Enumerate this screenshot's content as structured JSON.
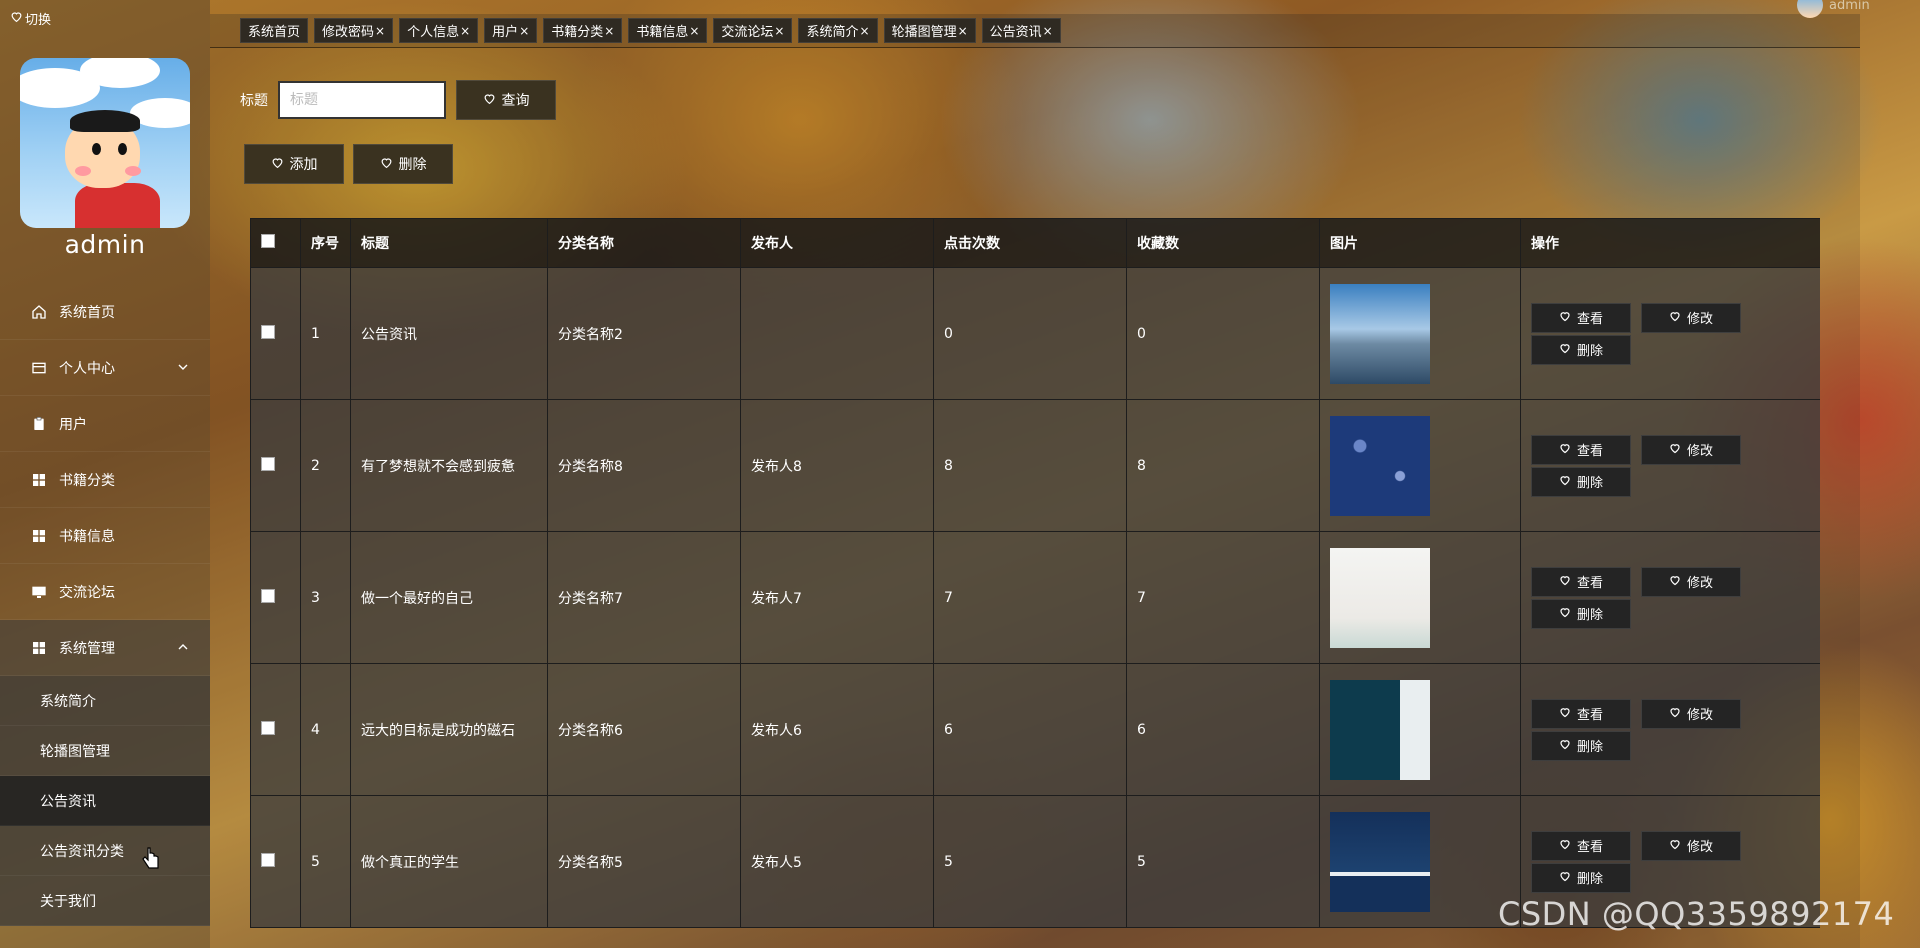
{
  "sidebar": {
    "switch_label": "切换",
    "username": "admin",
    "menu": [
      {
        "label": "系统首页",
        "icon": "home-icon"
      },
      {
        "label": "个人中心",
        "icon": "card-icon",
        "has_arrow": true
      },
      {
        "label": "用户",
        "icon": "clipboard-icon"
      },
      {
        "label": "书籍分类",
        "icon": "grid-icon"
      },
      {
        "label": "书籍信息",
        "icon": "grid-icon"
      },
      {
        "label": "交流论坛",
        "icon": "monitor-icon"
      },
      {
        "label": "系统管理",
        "icon": "grid-icon",
        "expanded": true
      }
    ],
    "submenu": [
      {
        "label": "系统简介"
      },
      {
        "label": "轮播图管理"
      },
      {
        "label": "公告资讯",
        "active": true
      },
      {
        "label": "公告资讯分类"
      },
      {
        "label": "关于我们"
      }
    ]
  },
  "tabs": [
    {
      "label": "系统首页",
      "closable": false
    },
    {
      "label": "修改密码",
      "closable": true
    },
    {
      "label": "个人信息",
      "closable": true
    },
    {
      "label": "用户",
      "closable": true
    },
    {
      "label": "书籍分类",
      "closable": true
    },
    {
      "label": "书籍信息",
      "closable": true
    },
    {
      "label": "交流论坛",
      "closable": true
    },
    {
      "label": "系统简介",
      "closable": true
    },
    {
      "label": "轮播图管理",
      "closable": true
    },
    {
      "label": "公告资讯",
      "closable": true
    }
  ],
  "header": {
    "user_name": "admin",
    "close_glyph": "×"
  },
  "search": {
    "label": "标题",
    "placeholder": "标题",
    "button": "查询"
  },
  "actions": {
    "add": "添加",
    "delete": "删除"
  },
  "table": {
    "headers": [
      "序号",
      "标题",
      "分类名称",
      "发布人",
      "点击次数",
      "收藏数",
      "图片",
      "操作"
    ],
    "rows": [
      {
        "no": "1",
        "title": "公告资讯",
        "category": "分类名称2",
        "publisher": "",
        "clicks": "0",
        "favorites": "0",
        "image": "city-skyline"
      },
      {
        "no": "2",
        "title": "有了梦想就不会感到疲惫",
        "category": "分类名称8",
        "publisher": "发布人8",
        "clicks": "8",
        "favorites": "8",
        "image": "blue-book-cover"
      },
      {
        "no": "3",
        "title": "做一个最好的自己",
        "category": "分类名称7",
        "publisher": "发布人7",
        "clicks": "7",
        "favorites": "7",
        "image": "reading-cover"
      },
      {
        "no": "4",
        "title": "远大的目标是成功的磁石",
        "category": "分类名称6",
        "publisher": "发布人6",
        "clicks": "6",
        "favorites": "6",
        "image": "teal-book-cover"
      },
      {
        "no": "5",
        "title": "做个真正的学生",
        "category": "分类名称5",
        "publisher": "发布人5",
        "clicks": "5",
        "favorites": "5",
        "image": "navy-book-cover"
      }
    ],
    "op_labels": {
      "view": "查看",
      "edit": "修改",
      "delete": "删除"
    }
  },
  "watermark": "CSDN @QQ3359892174",
  "colors": {
    "button_bg": "#2a261d",
    "table_header": "#191919",
    "table_cell": "#3c3c3c"
  }
}
